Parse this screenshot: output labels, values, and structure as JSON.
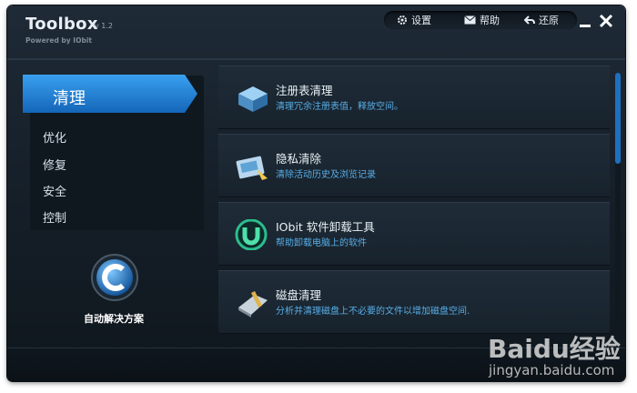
{
  "window": {
    "title": "Toolbox",
    "version": "v 1.2",
    "powered_by": "Powered by IObit",
    "top_menu": [
      {
        "label": "设置",
        "icon": "gear-icon"
      },
      {
        "label": "帮助",
        "icon": "mail-icon"
      },
      {
        "label": "还原",
        "icon": "undo-icon"
      }
    ]
  },
  "sidebar": {
    "active": "清理",
    "items": [
      {
        "label": "优化"
      },
      {
        "label": "修复"
      },
      {
        "label": "安全"
      },
      {
        "label": "控制"
      }
    ],
    "auto_fix_label": "自动解决方案"
  },
  "tools": [
    {
      "name": "注册表清理",
      "desc": "清理冗余注册表值，释放空间。",
      "icon": "registry-cleaner-icon"
    },
    {
      "name": "隐私清除",
      "desc": "清除活动历史及浏览记录",
      "icon": "privacy-sweep-icon"
    },
    {
      "name": "IObit 软件卸载工具",
      "desc": "帮助卸载电脑上的软件",
      "icon": "uninstaller-icon"
    },
    {
      "name": "磁盘清理",
      "desc": "分析并清理磁盘上不必要的文件以增加磁盘空间.",
      "icon": "disk-cleaner-icon"
    }
  ],
  "watermark": {
    "logo": "Baidu经验",
    "url": "jingyan.baidu.com"
  },
  "colors": {
    "accent": "#1e7fd6",
    "desc_text": "#57aee8",
    "background": "#17212b"
  }
}
